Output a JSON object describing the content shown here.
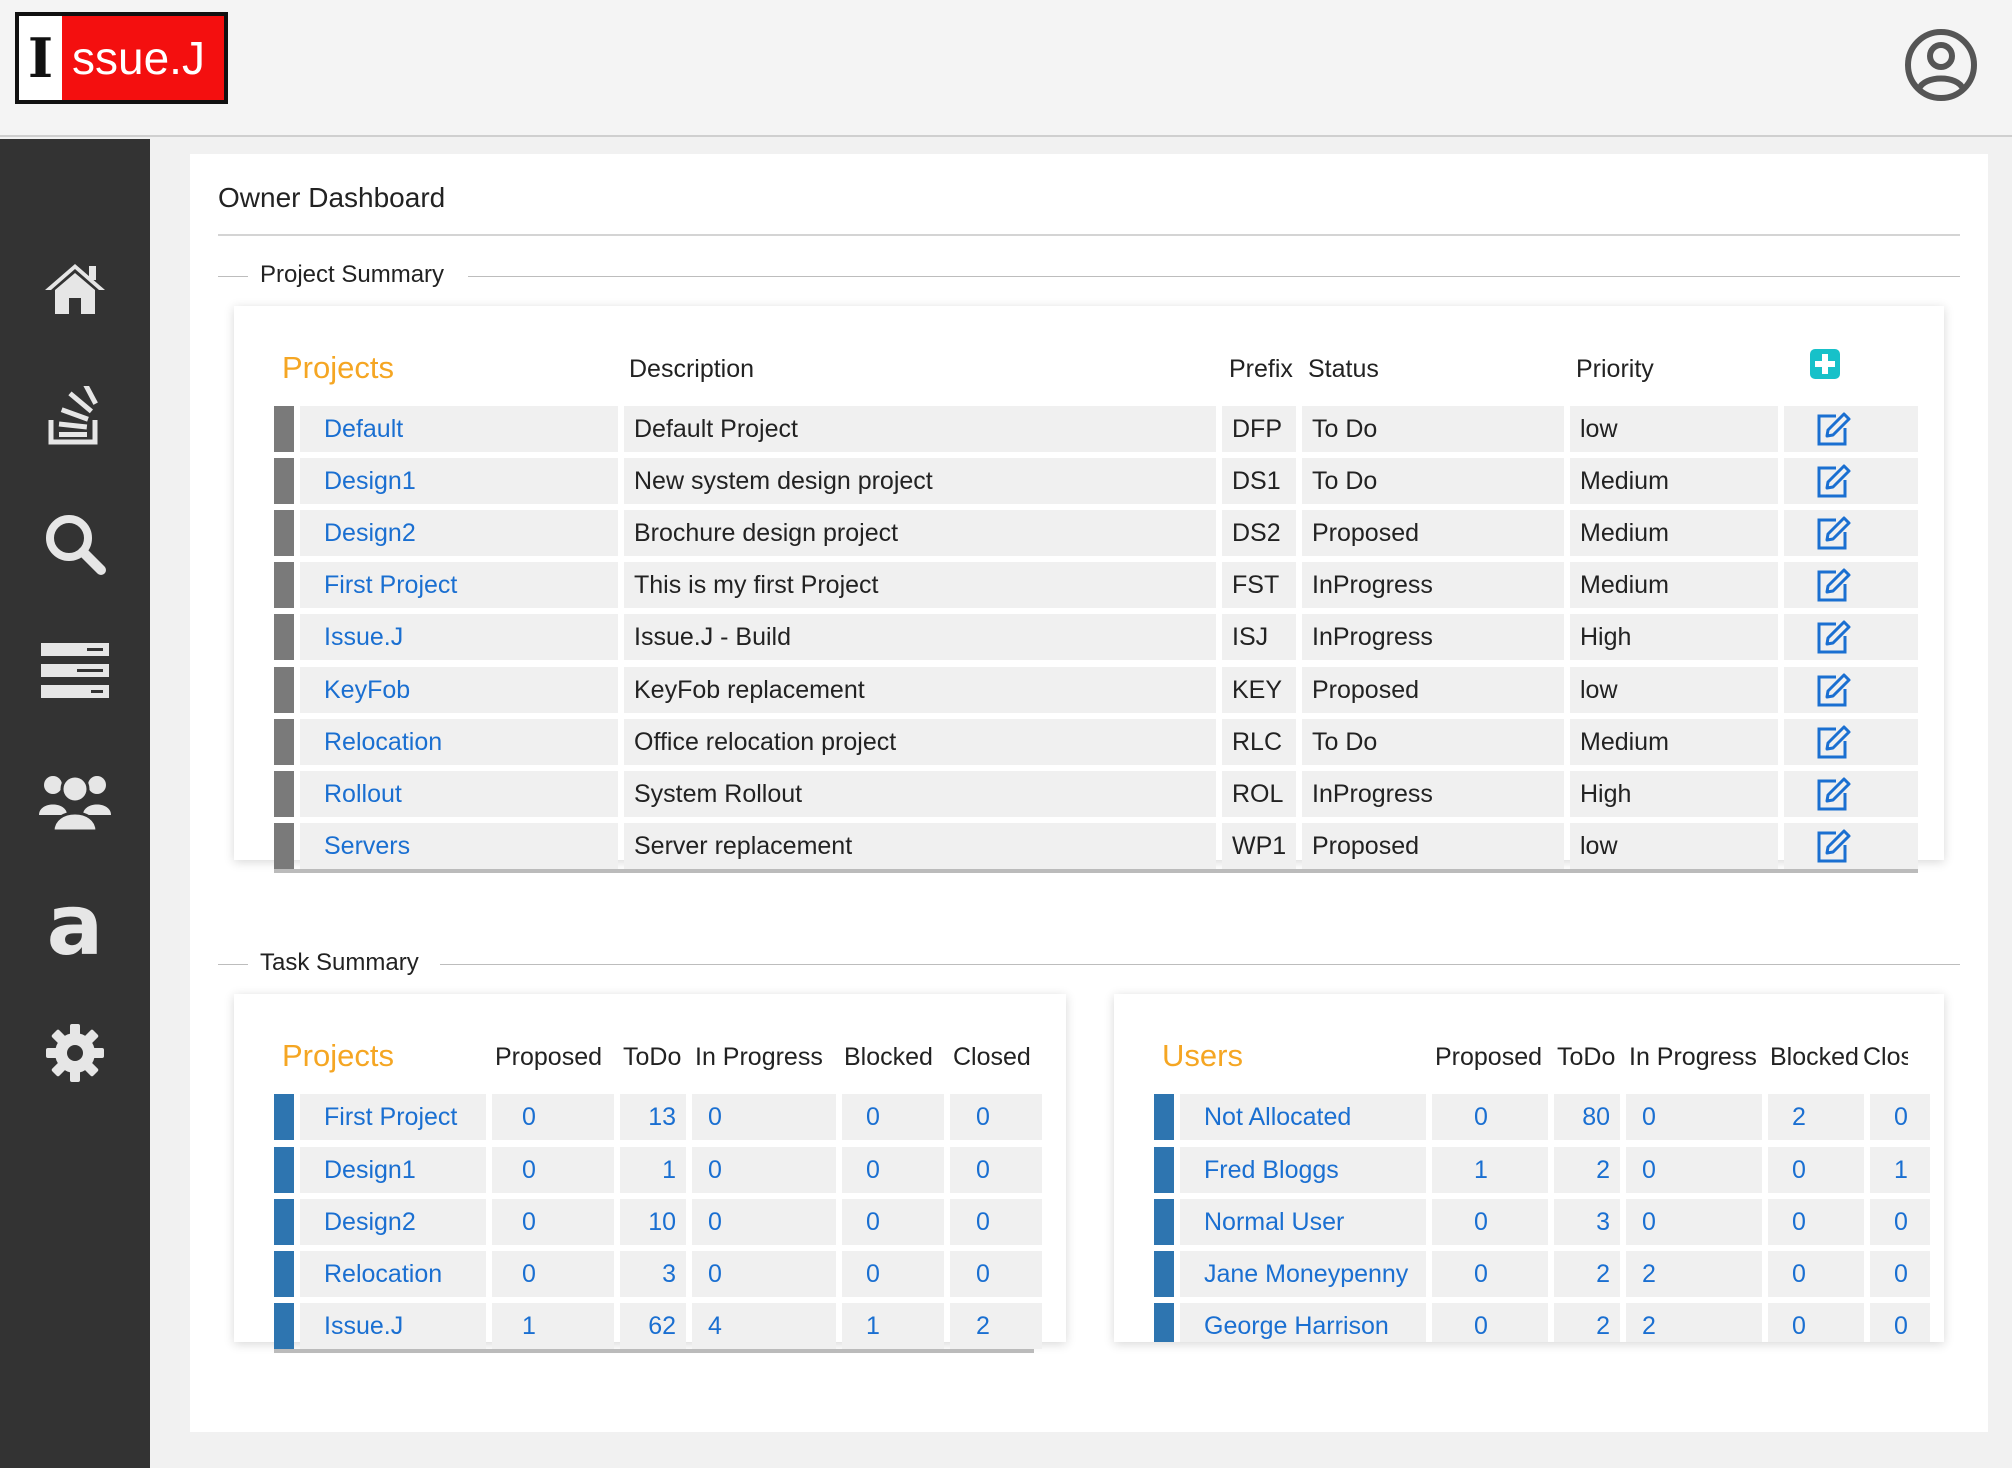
{
  "app": {
    "logo_letter": "I",
    "logo_rest": "ssue.J"
  },
  "header": {
    "user_icon": "user-circle-icon"
  },
  "sidebar": {
    "items": [
      {
        "icon": "home-icon"
      },
      {
        "icon": "stack-icon"
      },
      {
        "icon": "search-icon"
      },
      {
        "icon": "list-icon"
      },
      {
        "icon": "users-icon"
      },
      {
        "icon": "font-a-icon"
      },
      {
        "icon": "gear-icon"
      }
    ]
  },
  "page": {
    "title": "Owner Dashboard"
  },
  "project_summary": {
    "legend": "Project Summary",
    "headers": {
      "projects": "Projects",
      "description": "Description",
      "prefix": "Prefix",
      "status": "Status",
      "priority": "Priority"
    },
    "rows": [
      {
        "name": "Default",
        "description": "Default Project",
        "prefix": "DFP",
        "status": "To Do",
        "priority": "low"
      },
      {
        "name": "Design1",
        "description": "New system design project",
        "prefix": "DS1",
        "status": "To Do",
        "priority": "Medium"
      },
      {
        "name": "Design2",
        "description": "Brochure design project",
        "prefix": "DS2",
        "status": "Proposed",
        "priority": "Medium"
      },
      {
        "name": "First Project",
        "description": "This is my first Project",
        "prefix": "FST",
        "status": "InProgress",
        "priority": "Medium"
      },
      {
        "name": "Issue.J",
        "description": "Issue.J - Build",
        "prefix": "ISJ",
        "status": "InProgress",
        "priority": "High"
      },
      {
        "name": "KeyFob",
        "description": "KeyFob replacement",
        "prefix": "KEY",
        "status": "Proposed",
        "priority": "low"
      },
      {
        "name": "Relocation",
        "description": "Office relocation project",
        "prefix": "RLC",
        "status": "To Do",
        "priority": "Medium"
      },
      {
        "name": "Rollout",
        "description": "System Rollout",
        "prefix": "ROL",
        "status": "InProgress",
        "priority": "High"
      },
      {
        "name": "Servers",
        "description": "Server replacement",
        "prefix": "WP1",
        "status": "Proposed",
        "priority": "low"
      }
    ]
  },
  "task_summary": {
    "legend": "Task Summary",
    "projects": {
      "headers": {
        "name": "Projects",
        "proposed": "Proposed",
        "todo": "ToDo",
        "in_progress": "In Progress",
        "blocked": "Blocked",
        "closed": "Closed"
      },
      "rows": [
        {
          "name": "First Project",
          "proposed": "0",
          "todo": "13",
          "in_progress": "0",
          "blocked": "0",
          "closed": "0"
        },
        {
          "name": "Design1",
          "proposed": "0",
          "todo": "1",
          "in_progress": "0",
          "blocked": "0",
          "closed": "0"
        },
        {
          "name": "Design2",
          "proposed": "0",
          "todo": "10",
          "in_progress": "0",
          "blocked": "0",
          "closed": "0"
        },
        {
          "name": "Relocation",
          "proposed": "0",
          "todo": "3",
          "in_progress": "0",
          "blocked": "0",
          "closed": "0"
        },
        {
          "name": "Issue.J",
          "proposed": "1",
          "todo": "62",
          "in_progress": "4",
          "blocked": "1",
          "closed": "2"
        }
      ]
    },
    "users": {
      "headers": {
        "name": "Users",
        "proposed": "Proposed",
        "todo": "ToDo",
        "in_progress": "In Progress",
        "blocked": "Blocked",
        "closed": "Clos"
      },
      "rows": [
        {
          "name": "Not Allocated",
          "proposed": "0",
          "todo": "80",
          "in_progress": "0",
          "blocked": "2",
          "closed": "0"
        },
        {
          "name": "Fred Bloggs",
          "proposed": "1",
          "todo": "2",
          "in_progress": "0",
          "blocked": "0",
          "closed": "1"
        },
        {
          "name": "Normal User",
          "proposed": "0",
          "todo": "3",
          "in_progress": "0",
          "blocked": "0",
          "closed": "0"
        },
        {
          "name": "Jane Moneypenny",
          "proposed": "0",
          "todo": "2",
          "in_progress": "2",
          "blocked": "0",
          "closed": "0"
        },
        {
          "name": "George Harrison",
          "proposed": "0",
          "todo": "2",
          "in_progress": "2",
          "blocked": "0",
          "closed": "0"
        }
      ]
    }
  },
  "colors": {
    "accent_orange": "#f5a623",
    "link_blue": "#1a6fd1",
    "add_teal": "#17c1c9",
    "sidebar": "#333333",
    "logo_red": "#f40f0f"
  }
}
